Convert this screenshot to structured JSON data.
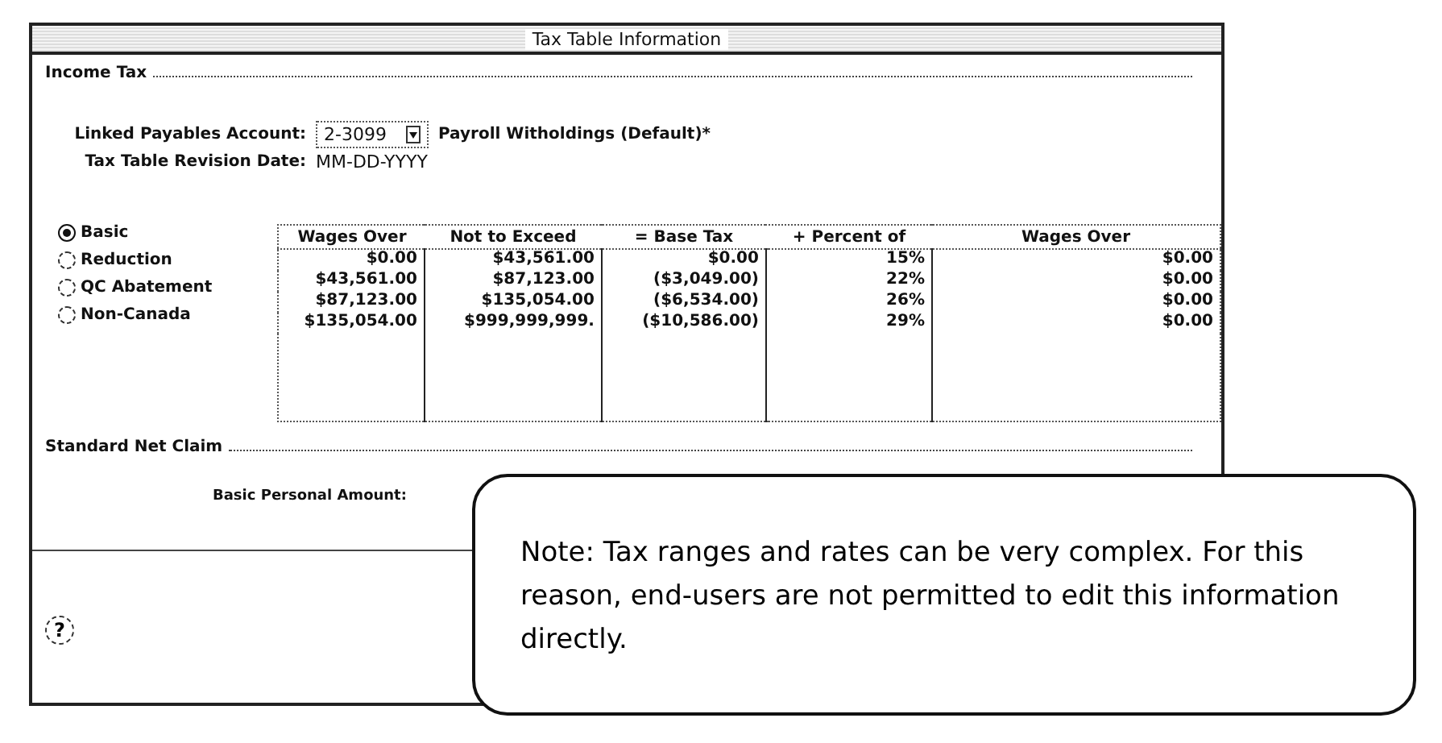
{
  "window": {
    "title": "Tax Table Information"
  },
  "income_tax": {
    "heading": "Income Tax",
    "linked_account_label": "Linked Payables Account:",
    "linked_account_value": "2-3099",
    "linked_account_name": "Payroll Witholdings (Default)*",
    "revision_label": "Tax Table Revision Date:",
    "revision_value": "MM-DD-YYYY"
  },
  "options": [
    {
      "label": "Basic",
      "selected": true
    },
    {
      "label": "Reduction",
      "selected": false
    },
    {
      "label": "QC Abatement",
      "selected": false
    },
    {
      "label": "Non-Canada",
      "selected": false
    }
  ],
  "table": {
    "columns": [
      "Wages Over",
      "Not to Exceed",
      "= Base Tax",
      "+ Percent of",
      "Wages Over"
    ],
    "rows": [
      [
        "$0.00",
        "$43,561.00",
        "$0.00",
        "15%",
        "$0.00"
      ],
      [
        "$43,561.00",
        "$87,123.00",
        "($3,049.00)",
        "22%",
        "$0.00"
      ],
      [
        "$87,123.00",
        "$135,054.00",
        "($6,534.00)",
        "26%",
        "$0.00"
      ],
      [
        "$135,054.00",
        "$999,999,999.",
        "($10,586.00)",
        "29%",
        "$0.00"
      ]
    ]
  },
  "standard_net_claim": {
    "heading": "Standard Net Claim",
    "basic_personal_amount_label": "Basic Personal Amount:"
  },
  "help_button": "?",
  "note": "Note: Tax ranges and rates can be very complex. For this reason, end-users are not permitted to edit this information directly."
}
